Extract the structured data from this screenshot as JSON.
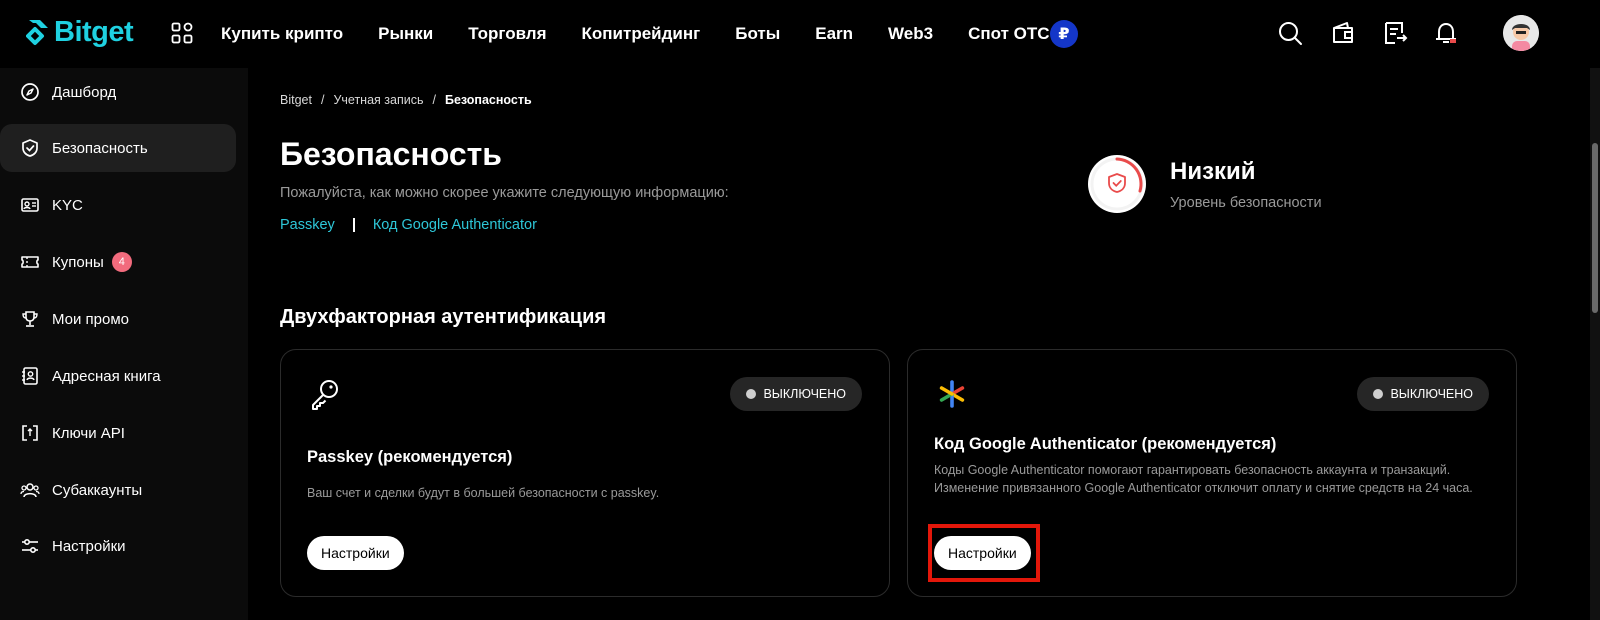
{
  "header": {
    "logo_text": "Bitget",
    "nav": [
      "Купить крипто",
      "Рынки",
      "Торговля",
      "Копитрейдинг",
      "Боты",
      "Earn",
      "Web3",
      "Спот OTC"
    ],
    "currency_symbol": "₽",
    "icons": [
      "search-icon",
      "wallet-icon",
      "orders-icon",
      "bell-icon",
      "avatar"
    ]
  },
  "sidebar": {
    "items": [
      {
        "label": "Дашборд",
        "icon": "compass-icon"
      },
      {
        "label": "Безопасность",
        "icon": "shield-icon",
        "active": true
      },
      {
        "label": "KYC",
        "icon": "id-card-icon"
      },
      {
        "label": "Купоны",
        "icon": "ticket-icon",
        "badge": "4"
      },
      {
        "label": "Мои промо",
        "icon": "trophy-icon"
      },
      {
        "label": "Адресная книга",
        "icon": "address-book-icon"
      },
      {
        "label": "Ключи API",
        "icon": "api-key-icon"
      },
      {
        "label": "Субаккаунты",
        "icon": "users-icon"
      },
      {
        "label": "Настройки",
        "icon": "sliders-icon"
      }
    ]
  },
  "breadcrumb": {
    "items": [
      "Bitget",
      "Учетная запись",
      "Безопасность"
    ],
    "separator": "/"
  },
  "page": {
    "title": "Безопасность",
    "subtitle": "Пожалуйста, как можно скорее укажите следующую информацию:",
    "links": [
      "Passkey",
      "Код Google Authenticator"
    ]
  },
  "security_level": {
    "title": "Низкий",
    "subtitle": "Уровень безопасности",
    "color": "#e94b4b"
  },
  "two_factor": {
    "section_title": "Двухфакторная аутентификация",
    "cards": [
      {
        "icon": "key-icon",
        "status": "ВЫКЛЮЧЕНО",
        "title": "Passkey (рекомендуется)",
        "description": "Ваш счет и сделки будут в большей безопасности с passkey.",
        "button": "Настройки"
      },
      {
        "icon": "google-authenticator-icon",
        "status": "ВЫКЛЮЧЕНО",
        "title": "Код Google Authenticator (рекомендуется)",
        "description": "Коды Google Authenticator помогают гарантировать безопасность аккаунта и транзакций. Изменение привязанного Google Authenticator отключит оплату и снятие средств на 24 часа.",
        "button": "Настройки"
      }
    ]
  },
  "colors": {
    "accent": "#1fd1e1",
    "link": "#2ec7d8",
    "highlight_border": "#e3170a",
    "badge": "#f26b7d"
  }
}
